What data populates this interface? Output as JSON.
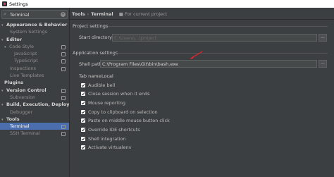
{
  "window": {
    "title": "Settings"
  },
  "search": {
    "value": "Terminal"
  },
  "tree": [
    {
      "label": "Appearance & Behavior",
      "bold": true,
      "arrow": "▾",
      "indent": 2
    },
    {
      "label": "System Settings",
      "indent": 14,
      "dim": true
    },
    {
      "label": "Editor",
      "bold": true,
      "arrow": "▾",
      "indent": 2
    },
    {
      "label": "Code Style",
      "arrow": "▾",
      "indent": 6,
      "dim": true,
      "proj": true
    },
    {
      "label": "JavaScript",
      "indent": 20,
      "dim": true,
      "proj": true
    },
    {
      "label": "TypeScript",
      "indent": 20,
      "dim": true,
      "proj": true
    },
    {
      "label": "Inspections",
      "indent": 14,
      "dim": true,
      "proj": true
    },
    {
      "label": "Live Templates",
      "indent": 14,
      "dim": true
    },
    {
      "label": "Plugins",
      "bold": true,
      "indent": 6
    },
    {
      "label": "Version Control",
      "bold": true,
      "arrow": "▾",
      "indent": 2,
      "proj": true
    },
    {
      "label": "Subversion",
      "indent": 14,
      "dim": true,
      "proj": true
    },
    {
      "label": "Build, Execution, Deployment",
      "bold": true,
      "arrow": "▾",
      "indent": 2
    },
    {
      "label": "Debugger",
      "indent": 14,
      "dim": true
    },
    {
      "label": "Tools",
      "bold": true,
      "arrow": "▾",
      "indent": 2
    },
    {
      "label": "Terminal",
      "indent": 14,
      "selected": true,
      "proj": true
    },
    {
      "label": "SSH Terminal",
      "indent": 14,
      "dim": true,
      "proj": true
    }
  ],
  "breadcrumb": {
    "section": "Tools",
    "page": "Terminal",
    "scope": "For current project"
  },
  "project_settings": {
    "group_title": "Project settings",
    "start_dir_label": "Start directory",
    "start_dir_placeholder": "C:\\Users\\...\\project"
  },
  "app_settings": {
    "group_title": "Application settings",
    "shell_label": "Shell path",
    "shell_value": "C:\\Program Files\\Git\\bin\\bash.exe",
    "tabname_label": "Tab name",
    "tabname_value": "Local",
    "browse_label": "..."
  },
  "checkboxes": [
    {
      "label": "Audible bell",
      "checked": true
    },
    {
      "label": "Close session when it ends",
      "checked": true
    },
    {
      "label": "Mouse reporting",
      "checked": true
    },
    {
      "label": "Copy to clipboard on selection",
      "checked": true
    },
    {
      "label": "Paste on middle mouse button click",
      "checked": true
    },
    {
      "label": "Override IDE shortcuts",
      "checked": true
    },
    {
      "label": "Shell integration",
      "checked": true
    },
    {
      "label": "Activate virtualenv",
      "checked": true
    }
  ],
  "colors": {
    "selection": "#4b6eaf",
    "panel": "#3c3f41",
    "annotation": "#e8242b"
  }
}
